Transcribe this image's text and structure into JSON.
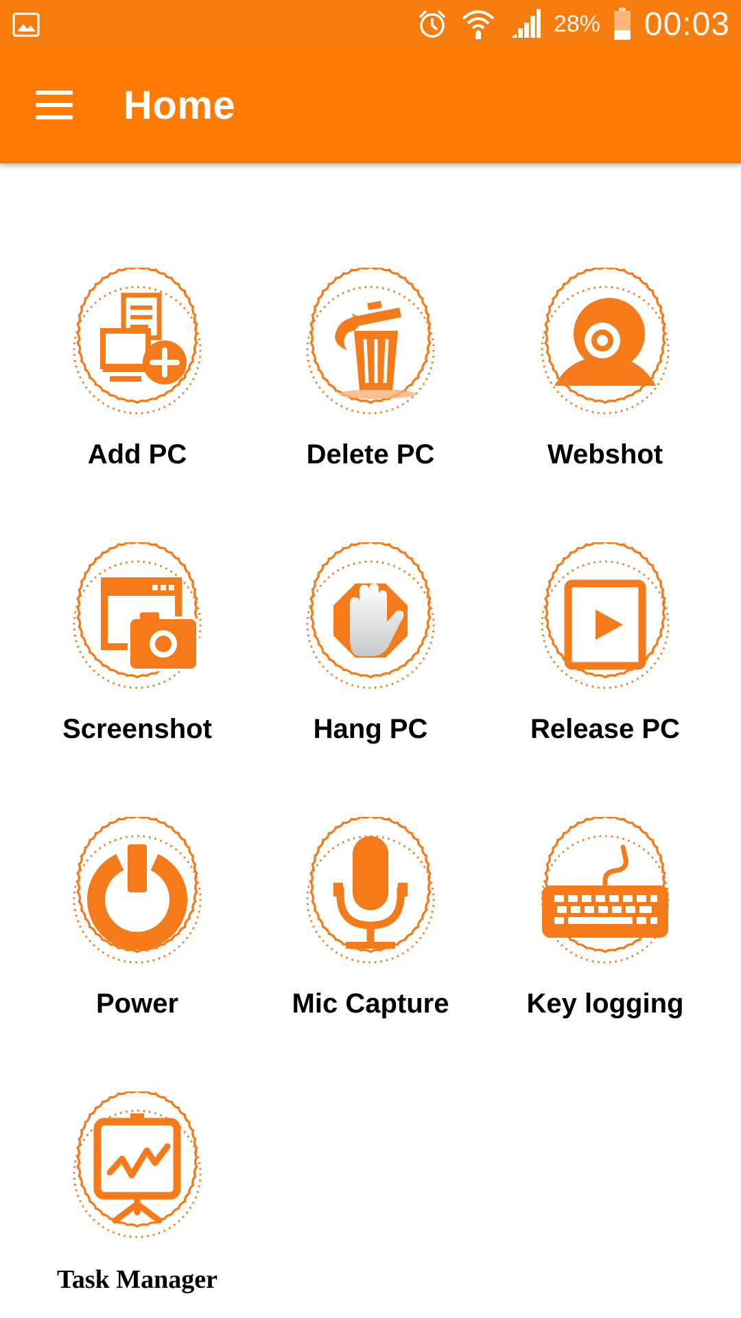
{
  "status_bar": {
    "battery_percent": "28%",
    "time": "00:03",
    "icons": [
      "gallery-icon",
      "alarm-icon",
      "wifi-icon",
      "signal-icon",
      "battery-icon"
    ]
  },
  "app_bar": {
    "title": "Home",
    "menu_icon": "hamburger-menu-icon"
  },
  "accent_color": "#ff7a02",
  "items": [
    {
      "label": "Add PC",
      "icon": "add-pc-icon"
    },
    {
      "label": "Delete PC",
      "icon": "trash-icon"
    },
    {
      "label": "Webshot",
      "icon": "webcam-icon"
    },
    {
      "label": "Screenshot",
      "icon": "screenshot-camera-icon"
    },
    {
      "label": "Hang PC",
      "icon": "stop-hand-icon"
    },
    {
      "label": "Release PC",
      "icon": "play-icon"
    },
    {
      "label": "Power",
      "icon": "power-icon"
    },
    {
      "label": "Mic Capture",
      "icon": "microphone-icon"
    },
    {
      "label": "Key logging",
      "icon": "keyboard-icon"
    },
    {
      "label": "Task Manager",
      "icon": "presentation-chart-icon"
    }
  ]
}
